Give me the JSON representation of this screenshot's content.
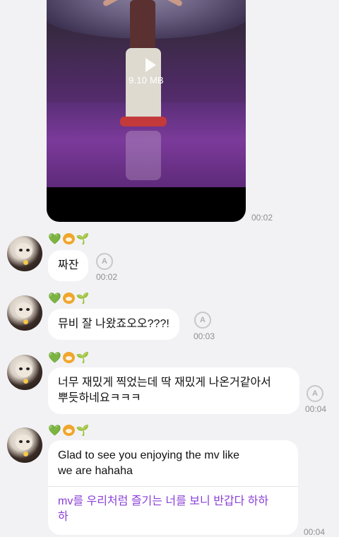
{
  "video": {
    "size_label": "9.10 MB",
    "time": "00:02"
  },
  "messages": [
    {
      "badges": [
        "green-heart",
        "tiger-face",
        "seedling"
      ],
      "text": "짜잔",
      "time": "00:02"
    },
    {
      "badges": [
        "green-heart",
        "tiger-face",
        "seedling"
      ],
      "text": "뮤비 잘 나왔죠오오???!",
      "time": "00:03"
    },
    {
      "badges": [
        "green-heart",
        "tiger-face",
        "seedling"
      ],
      "text_line1": "너무 재밌게 찍었는데 딱 재밌게 나온거같아서",
      "text_line2": "뿌듯하네요ㅋㅋㅋ",
      "time": "00:04"
    },
    {
      "badges": [
        "green-heart",
        "tiger-face",
        "seedling"
      ],
      "text_line1": "Glad to see you enjoying the mv like",
      "text_line2": "we are hahaha",
      "translation_line1": "mv를 우리처럼 즐기는 너를 보니 반갑다 하하",
      "translation_line2": "하",
      "time": "00:04"
    }
  ],
  "colors": {
    "background": "#f2f2f5",
    "bubble": "#ffffff",
    "translation_text": "#8a3fd6",
    "timestamp": "#8e8e93"
  },
  "icons": {
    "play": "play-icon",
    "translate": "translate-icon",
    "heart": "💚",
    "sprout": "🌱"
  }
}
